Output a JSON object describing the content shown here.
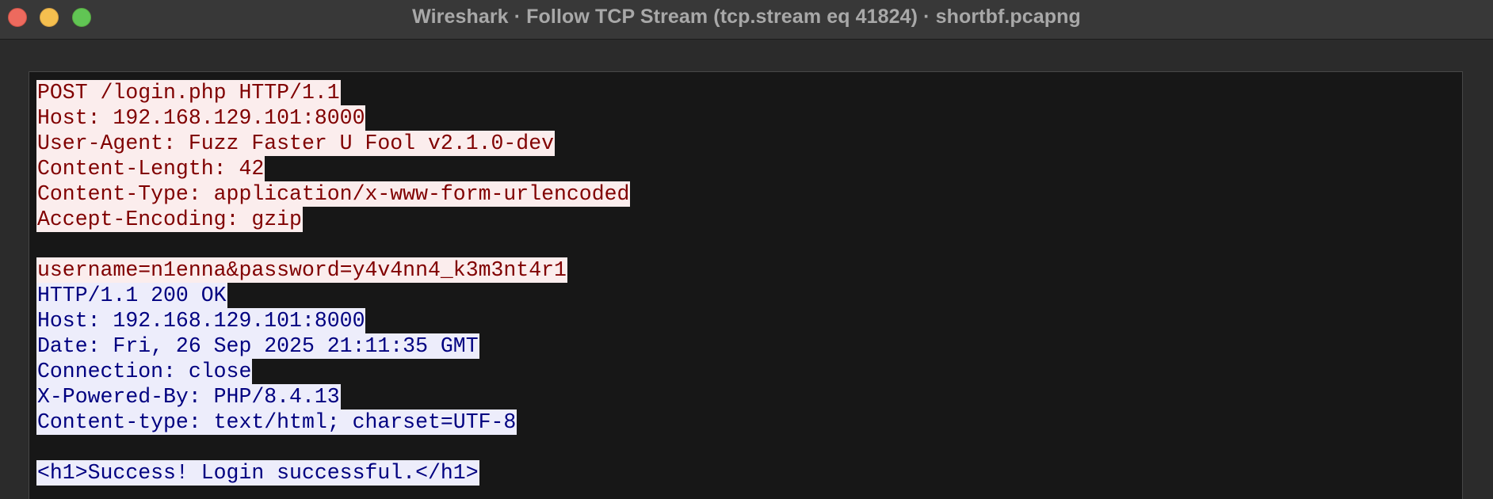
{
  "window": {
    "title": "Wireshark · Follow TCP Stream (tcp.stream eq 41824) · shortbf.pcapng"
  },
  "colors": {
    "client_fg": "#800000",
    "client_bg": "#fbeded",
    "server_fg": "#000080",
    "server_bg": "#ededfb",
    "pane_bg": "#171717"
  },
  "stream": {
    "client": [
      "POST /login.php HTTP/1.1",
      "Host: 192.168.129.101:8000",
      "User-Agent: Fuzz Faster U Fool v2.1.0-dev",
      "Content-Length: 42",
      "Content-Type: application/x-www-form-urlencoded",
      "Accept-Encoding: gzip",
      "",
      "username=n1enna&password=y4v4nn4_k3m3nt4r1"
    ],
    "server": [
      "HTTP/1.1 200 OK",
      "Host: 192.168.129.101:8000",
      "Date: Fri, 26 Sep 2025 21:11:35 GMT",
      "Connection: close",
      "X-Powered-By: PHP/8.4.13",
      "Content-type: text/html; charset=UTF-8",
      "",
      "<h1>Success! Login successful.</h1>"
    ]
  }
}
